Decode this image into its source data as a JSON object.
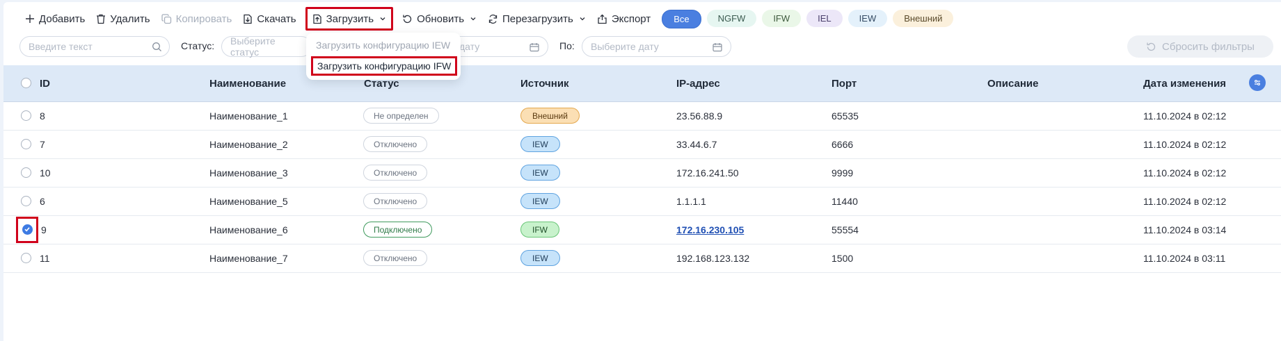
{
  "toolbar": {
    "add": "Добавить",
    "delete": "Удалить",
    "copy": "Копировать",
    "download": "Скачать",
    "upload": "Загрузить",
    "refresh": "Обновить",
    "reload": "Перезагрузить",
    "export": "Экспорт"
  },
  "chips": [
    "Все",
    "NGFW",
    "IFW",
    "IEL",
    "IEW",
    "Внешний"
  ],
  "filters": {
    "search_placeholder": "Введите текст",
    "status_label": "Статус:",
    "status_placeholder": "Выберите статус",
    "date_from_placeholder": "дату",
    "to_label": "По:",
    "date_to_placeholder": "Выберите дату",
    "reset": "Сбросить фильтры"
  },
  "dropdown": {
    "items": [
      "Загрузить конфигурацию IEW",
      "Загрузить конфигурацию IFW"
    ]
  },
  "table": {
    "columns": [
      "ID",
      "Наименование",
      "Статус",
      "Источник",
      "IP-адрес",
      "Порт",
      "Описание",
      "Дата изменения"
    ],
    "rows": [
      {
        "id": "8",
        "name": "Наименование_1",
        "status": "Не определен",
        "source": "Внешний",
        "ip": "23.56.88.9",
        "port": "65535",
        "desc": "",
        "date": "11.10.2024 в 02:12"
      },
      {
        "id": "7",
        "name": "Наименование_2",
        "status": "Отключено",
        "source": "IEW",
        "ip": "33.44.6.7",
        "port": "6666",
        "desc": "",
        "date": "11.10.2024 в 02:12"
      },
      {
        "id": "10",
        "name": "Наименование_3",
        "status": "Отключено",
        "source": "IEW",
        "ip": "172.16.241.50",
        "port": "9999",
        "desc": "",
        "date": "11.10.2024 в 02:12"
      },
      {
        "id": "6",
        "name": "Наименование_5",
        "status": "Отключено",
        "source": "IEW",
        "ip": "1.1.1.1",
        "port": "11440",
        "desc": "",
        "date": "11.10.2024 в 02:12"
      },
      {
        "id": "9",
        "name": "Наименование_6",
        "status": "Подключено",
        "source": "IFW",
        "ip": "172.16.230.105",
        "port": "55554",
        "desc": "",
        "date": "11.10.2024 в 03:14"
      },
      {
        "id": "11",
        "name": "Наименование_7",
        "status": "Отключено",
        "source": "IEW",
        "ip": "192.168.123.132",
        "port": "1500",
        "desc": "",
        "date": "11.10.2024 в 03:11"
      }
    ]
  }
}
